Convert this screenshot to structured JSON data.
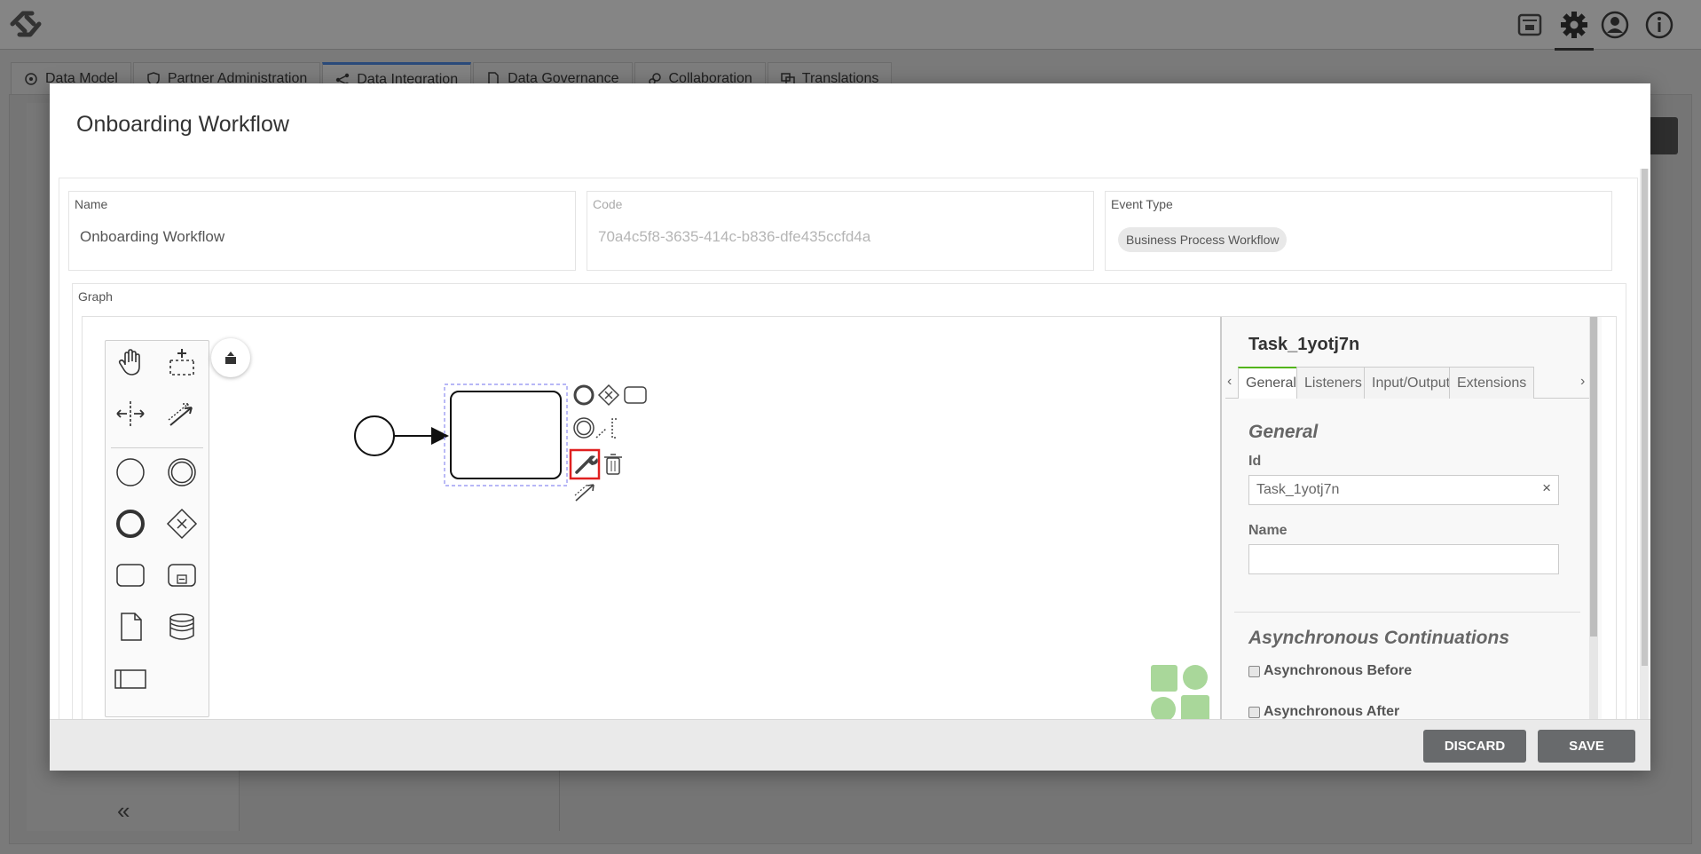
{
  "top_tabs": [
    {
      "label": "Data Model",
      "icon": "data-model-icon"
    },
    {
      "label": "Partner Administration",
      "icon": "shield-icon"
    },
    {
      "label": "Data Integration",
      "icon": "integration-icon",
      "active": true
    },
    {
      "label": "Data Governance",
      "icon": "document-icon"
    },
    {
      "label": "Collaboration",
      "icon": "collaboration-icon"
    },
    {
      "label": "Translations",
      "icon": "translate-icon"
    }
  ],
  "modal": {
    "title": "Onboarding Workflow",
    "fields": {
      "name_label": "Name",
      "name_value": "Onboarding Workflow",
      "code_label": "Code",
      "code_value": "70a4c5f8-3635-414c-b836-dfe435ccfd4a",
      "event_type_label": "Event Type",
      "event_type_value": "Business Process Workflow"
    },
    "graph_label": "Graph",
    "discard_label": "DISCARD",
    "save_label": "SAVE"
  },
  "properties": {
    "title": "Task_1yotj7n",
    "tab_prev": "‹",
    "tab_next": "›",
    "tabs": [
      "General",
      "Listeners",
      "Input/Output",
      "Extensions"
    ],
    "active_tab": "General",
    "general_title": "General",
    "id_label": "Id",
    "id_value": "Task_1yotj7n",
    "id_clear": "×",
    "name_label": "Name",
    "name_value": "",
    "async_title": "Asynchronous Continuations",
    "async_before_label": "Asynchronous Before",
    "async_after_label": "Asynchronous After"
  },
  "sidebar": {
    "collapse_glyph": "«"
  },
  "colors": {
    "accent_tab": "#52b415",
    "button": "#686a6c",
    "highlight": "#e02020",
    "selection": "#8c8cf0"
  }
}
